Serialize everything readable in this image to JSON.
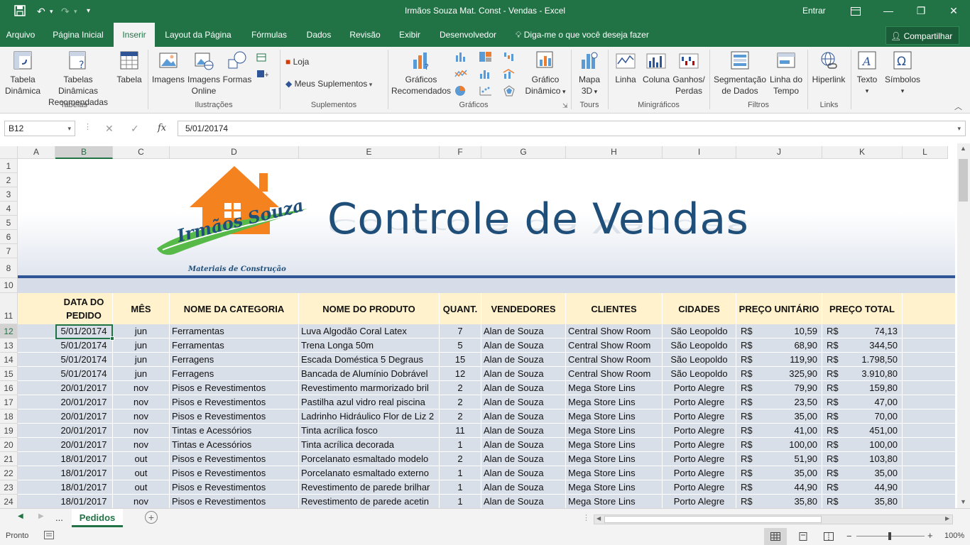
{
  "window": {
    "title": "Irmãos Souza Mat. Const - Vendas  -  Excel",
    "signin": "Entrar"
  },
  "ribbon_tabs": [
    "Arquivo",
    "Página Inicial",
    "Inserir",
    "Layout da Página",
    "Fórmulas",
    "Dados",
    "Revisão",
    "Exibir",
    "Desenvolvedor"
  ],
  "tell_me": "Diga-me o que você deseja fazer",
  "share": "Compartilhar",
  "ribbon": {
    "tabela_dinamica": [
      "Tabela",
      "Dinâmica"
    ],
    "tabelas_recomendadas": [
      "Tabelas Dinâmicas",
      "Recomendadas"
    ],
    "tabela": "Tabela",
    "imagens": "Imagens",
    "imagens_online": [
      "Imagens",
      "Online"
    ],
    "formas": "Formas",
    "loja": "Loja",
    "meus_suplementos": "Meus Suplementos",
    "graficos_recomendados": [
      "Gráficos",
      "Recomendados"
    ],
    "grafico_dinamico": [
      "Gráfico",
      "Dinâmico"
    ],
    "mapa_3d": [
      "Mapa",
      "3D"
    ],
    "linha": "Linha",
    "coluna": "Coluna",
    "ganhos_perdas": [
      "Ganhos/",
      "Perdas"
    ],
    "segmentacao": [
      "Segmentação",
      "de Dados"
    ],
    "linha_do_tempo": [
      "Linha do",
      "Tempo"
    ],
    "hiperlink": "Hiperlink",
    "texto": "Texto",
    "simbolos": "Símbolos",
    "groups": [
      "Tabelas",
      "Ilustrações",
      "Suplementos",
      "Gráficos",
      "Tours",
      "Minigráficos",
      "Filtros",
      "Links"
    ]
  },
  "formula_bar": {
    "name_box": "B12",
    "fx": "fx",
    "value": "5/01/20174"
  },
  "columns": [
    "A",
    "B",
    "C",
    "D",
    "E",
    "F",
    "G",
    "H",
    "I",
    "J",
    "K",
    "L"
  ],
  "row_numbers": [
    "1",
    "2",
    "3",
    "4",
    "5",
    "6",
    "7",
    "8",
    "10",
    "11",
    "12",
    "13",
    "14",
    "15",
    "16",
    "17",
    "18",
    "19",
    "20",
    "21",
    "22",
    "23",
    "24"
  ],
  "banner": {
    "heading": "Controle de Vendas",
    "logo_name": "Irmãos Souza",
    "logo_sub": "Materiais de Construção",
    "house_color": "#f4831f",
    "swoosh_color": "#57b947",
    "heading_color": "#1f4e79"
  },
  "table": {
    "headers": [
      [
        "DATA DO",
        "PEDIDO"
      ],
      [
        "MÊS"
      ],
      [
        "NOME DA CATEGORIA"
      ],
      [
        "NOME DO PRODUTO"
      ],
      [
        "QUANT."
      ],
      [
        "VENDEDORES"
      ],
      [
        "CLIENTES"
      ],
      [
        "CIDADES"
      ],
      [
        "PREÇO UNITÁRIO"
      ],
      [
        "PREÇO TOTAL"
      ]
    ],
    "currency": "R$",
    "rows": [
      [
        "5/01/20174",
        "jun",
        "Ferramentas",
        "Luva Algodão Coral Latex",
        "7",
        "Alan de Souza",
        "Central Show Room",
        "São Leopoldo",
        "10,59",
        "74,13"
      ],
      [
        "5/01/20174",
        "jun",
        "Ferramentas",
        "Trena Longa 50m",
        "5",
        "Alan de Souza",
        "Central Show Room",
        "São Leopoldo",
        "68,90",
        "344,50"
      ],
      [
        "5/01/20174",
        "jun",
        "Ferragens",
        "Escada Doméstica 5 Degraus",
        "15",
        "Alan de Souza",
        "Central Show Room",
        "São Leopoldo",
        "119,90",
        "1.798,50"
      ],
      [
        "5/01/20174",
        "jun",
        "Ferragens",
        "Bancada de Alumínio Dobrável",
        "12",
        "Alan de Souza",
        "Central Show Room",
        "São Leopoldo",
        "325,90",
        "3.910,80"
      ],
      [
        "20/01/2017",
        "nov",
        "Pisos e Revestimentos",
        "Revestimento marmorizado bril",
        "2",
        "Alan de Souza",
        "Mega Store Lins",
        "Porto Alegre",
        "79,90",
        "159,80"
      ],
      [
        "20/01/2017",
        "nov",
        "Pisos e Revestimentos",
        "Pastilha azul vidro real piscina",
        "2",
        "Alan de Souza",
        "Mega Store Lins",
        "Porto Alegre",
        "23,50",
        "47,00"
      ],
      [
        "20/01/2017",
        "nov",
        "Pisos e Revestimentos",
        "Ladrinho Hidráulico Flor de Liz 2",
        "2",
        "Alan de Souza",
        "Mega Store Lins",
        "Porto Alegre",
        "35,00",
        "70,00"
      ],
      [
        "20/01/2017",
        "nov",
        "Tintas e Acessórios",
        "Tinta acrílica fosco",
        "11",
        "Alan de Souza",
        "Mega Store Lins",
        "Porto Alegre",
        "41,00",
        "451,00"
      ],
      [
        "20/01/2017",
        "nov",
        "Tintas e Acessórios",
        "Tinta acrílica decorada",
        "1",
        "Alan de Souza",
        "Mega Store Lins",
        "Porto Alegre",
        "100,00",
        "100,00"
      ],
      [
        "18/01/2017",
        "out",
        "Pisos e Revestimentos",
        "Porcelanato esmaltado modelo",
        "2",
        "Alan de Souza",
        "Mega Store Lins",
        "Porto Alegre",
        "51,90",
        "103,80"
      ],
      [
        "18/01/2017",
        "out",
        "Pisos e Revestimentos",
        "Porcelanato esmaltado externo",
        "1",
        "Alan de Souza",
        "Mega Store Lins",
        "Porto Alegre",
        "35,00",
        "35,00"
      ],
      [
        "18/01/2017",
        "out",
        "Pisos e Revestimentos",
        "Revestimento de parede brilhar",
        "1",
        "Alan de Souza",
        "Mega Store Lins",
        "Porto Alegre",
        "44,90",
        "44,90"
      ],
      [
        "18/01/2017",
        "nov",
        "Pisos e Revestimentos",
        "Revestimento de parede acetin",
        "1",
        "Alan de Souza",
        "Mega Store Lins",
        "Porto Alegre",
        "35,80",
        "35,80"
      ]
    ]
  },
  "sheets": {
    "ellipsis": "...",
    "active": "Pedidos"
  },
  "status": {
    "ready": "Pronto",
    "zoom": "100%"
  },
  "colors": {
    "excel_green": "#217346",
    "header_fill": "#fff2cc",
    "row_fill": "#d9dfe9",
    "band_line": "#2f5597"
  }
}
